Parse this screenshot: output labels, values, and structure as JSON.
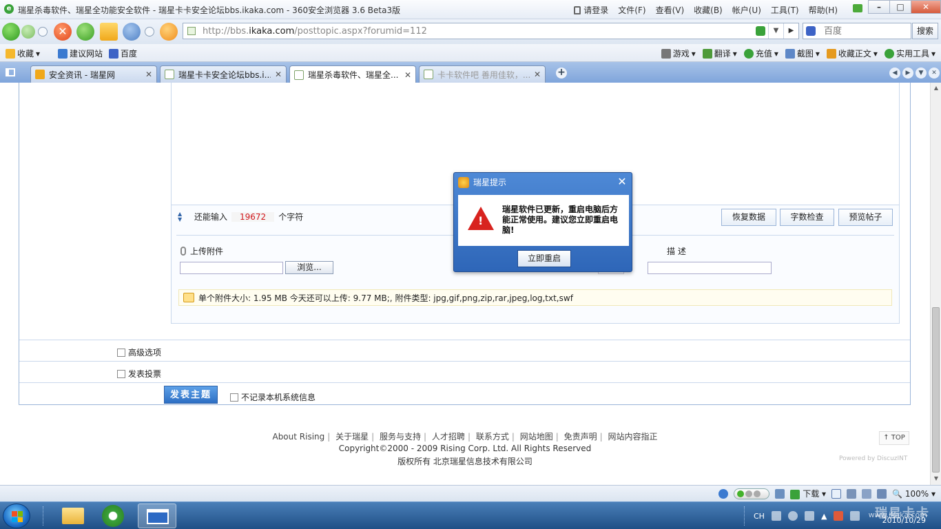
{
  "window": {
    "title": "瑞星杀毒软件、瑞星全功能安全软件 - 瑞星卡卡安全论坛bbs.ikaka.com - 360安全浏览器 3.6 Beta3版",
    "login": "请登录",
    "menus": [
      "文件(F)",
      "查看(V)",
      "收藏(B)",
      "帐户(U)",
      "工具(T)",
      "帮助(H)"
    ]
  },
  "navbar": {
    "url_prefix": "http://bbs.",
    "url_domain": "ikaka.com",
    "url_suffix": "/posttopic.aspx?forumid=112",
    "search_placeholder": "百度",
    "search_button": "搜索"
  },
  "favbar": {
    "left": [
      "收藏",
      "建议网站",
      "百度"
    ],
    "right": [
      "游戏",
      "翻译",
      "充值",
      "截图",
      "收藏正文",
      "实用工具"
    ]
  },
  "tabs": [
    {
      "label": "安全资讯 - 瑞星网",
      "active": false
    },
    {
      "label": "瑞星卡卡安全论坛bbs.i...",
      "active": false
    },
    {
      "label": "瑞星杀毒软件、瑞星全...",
      "active": true
    },
    {
      "label": "卡卡软件吧 善用佳软，...",
      "active": false
    }
  ],
  "editor": {
    "counter_prefix": "还能输入",
    "counter_value": "19672",
    "counter_suffix": "个字符",
    "restore_btn": "恢复数据",
    "wordcheck_btn": "字数检查",
    "preview_btn": "预览帖子"
  },
  "upload": {
    "label": "上传附件",
    "browse": "浏览...",
    "desc_label": "描 述",
    "notice": "单个附件大小: 1.95 MB  今天还可以上传: 9.77 MB;, 附件类型: jpg,gif,png,zip,rar,jpeg,log,txt,swf"
  },
  "options": {
    "advanced": "高级选项",
    "poll": "发表投票",
    "submit": "发表主题",
    "no_record": "不记录本机系统信息"
  },
  "footer": {
    "links": [
      "About Rising",
      "关于瑞星",
      "服务与支持",
      "人才招聘",
      "联系方式",
      "网站地图",
      "免责声明",
      "网站内容指正"
    ],
    "copyright": "Copyright©2000 - 2009 Rising Corp. Ltd.  All Rights Reserved",
    "rights": "版权所有 北京瑞星信息技术有限公司",
    "top": "TOP",
    "powered": "Powered by DiscuzINT"
  },
  "dialog": {
    "title": "瑞星提示",
    "message": "瑞星软件已更新，重启电脑后方能正常使用。建议您立即重启电脑!",
    "button": "立即重启"
  },
  "statusbar": {
    "download": "下载",
    "zoom": "100%"
  },
  "taskbar": {
    "lang": "CH",
    "date": "2010/10/29",
    "watermark": "瑞星卡卡",
    "watermark_sub": "www.ikaka.com"
  }
}
